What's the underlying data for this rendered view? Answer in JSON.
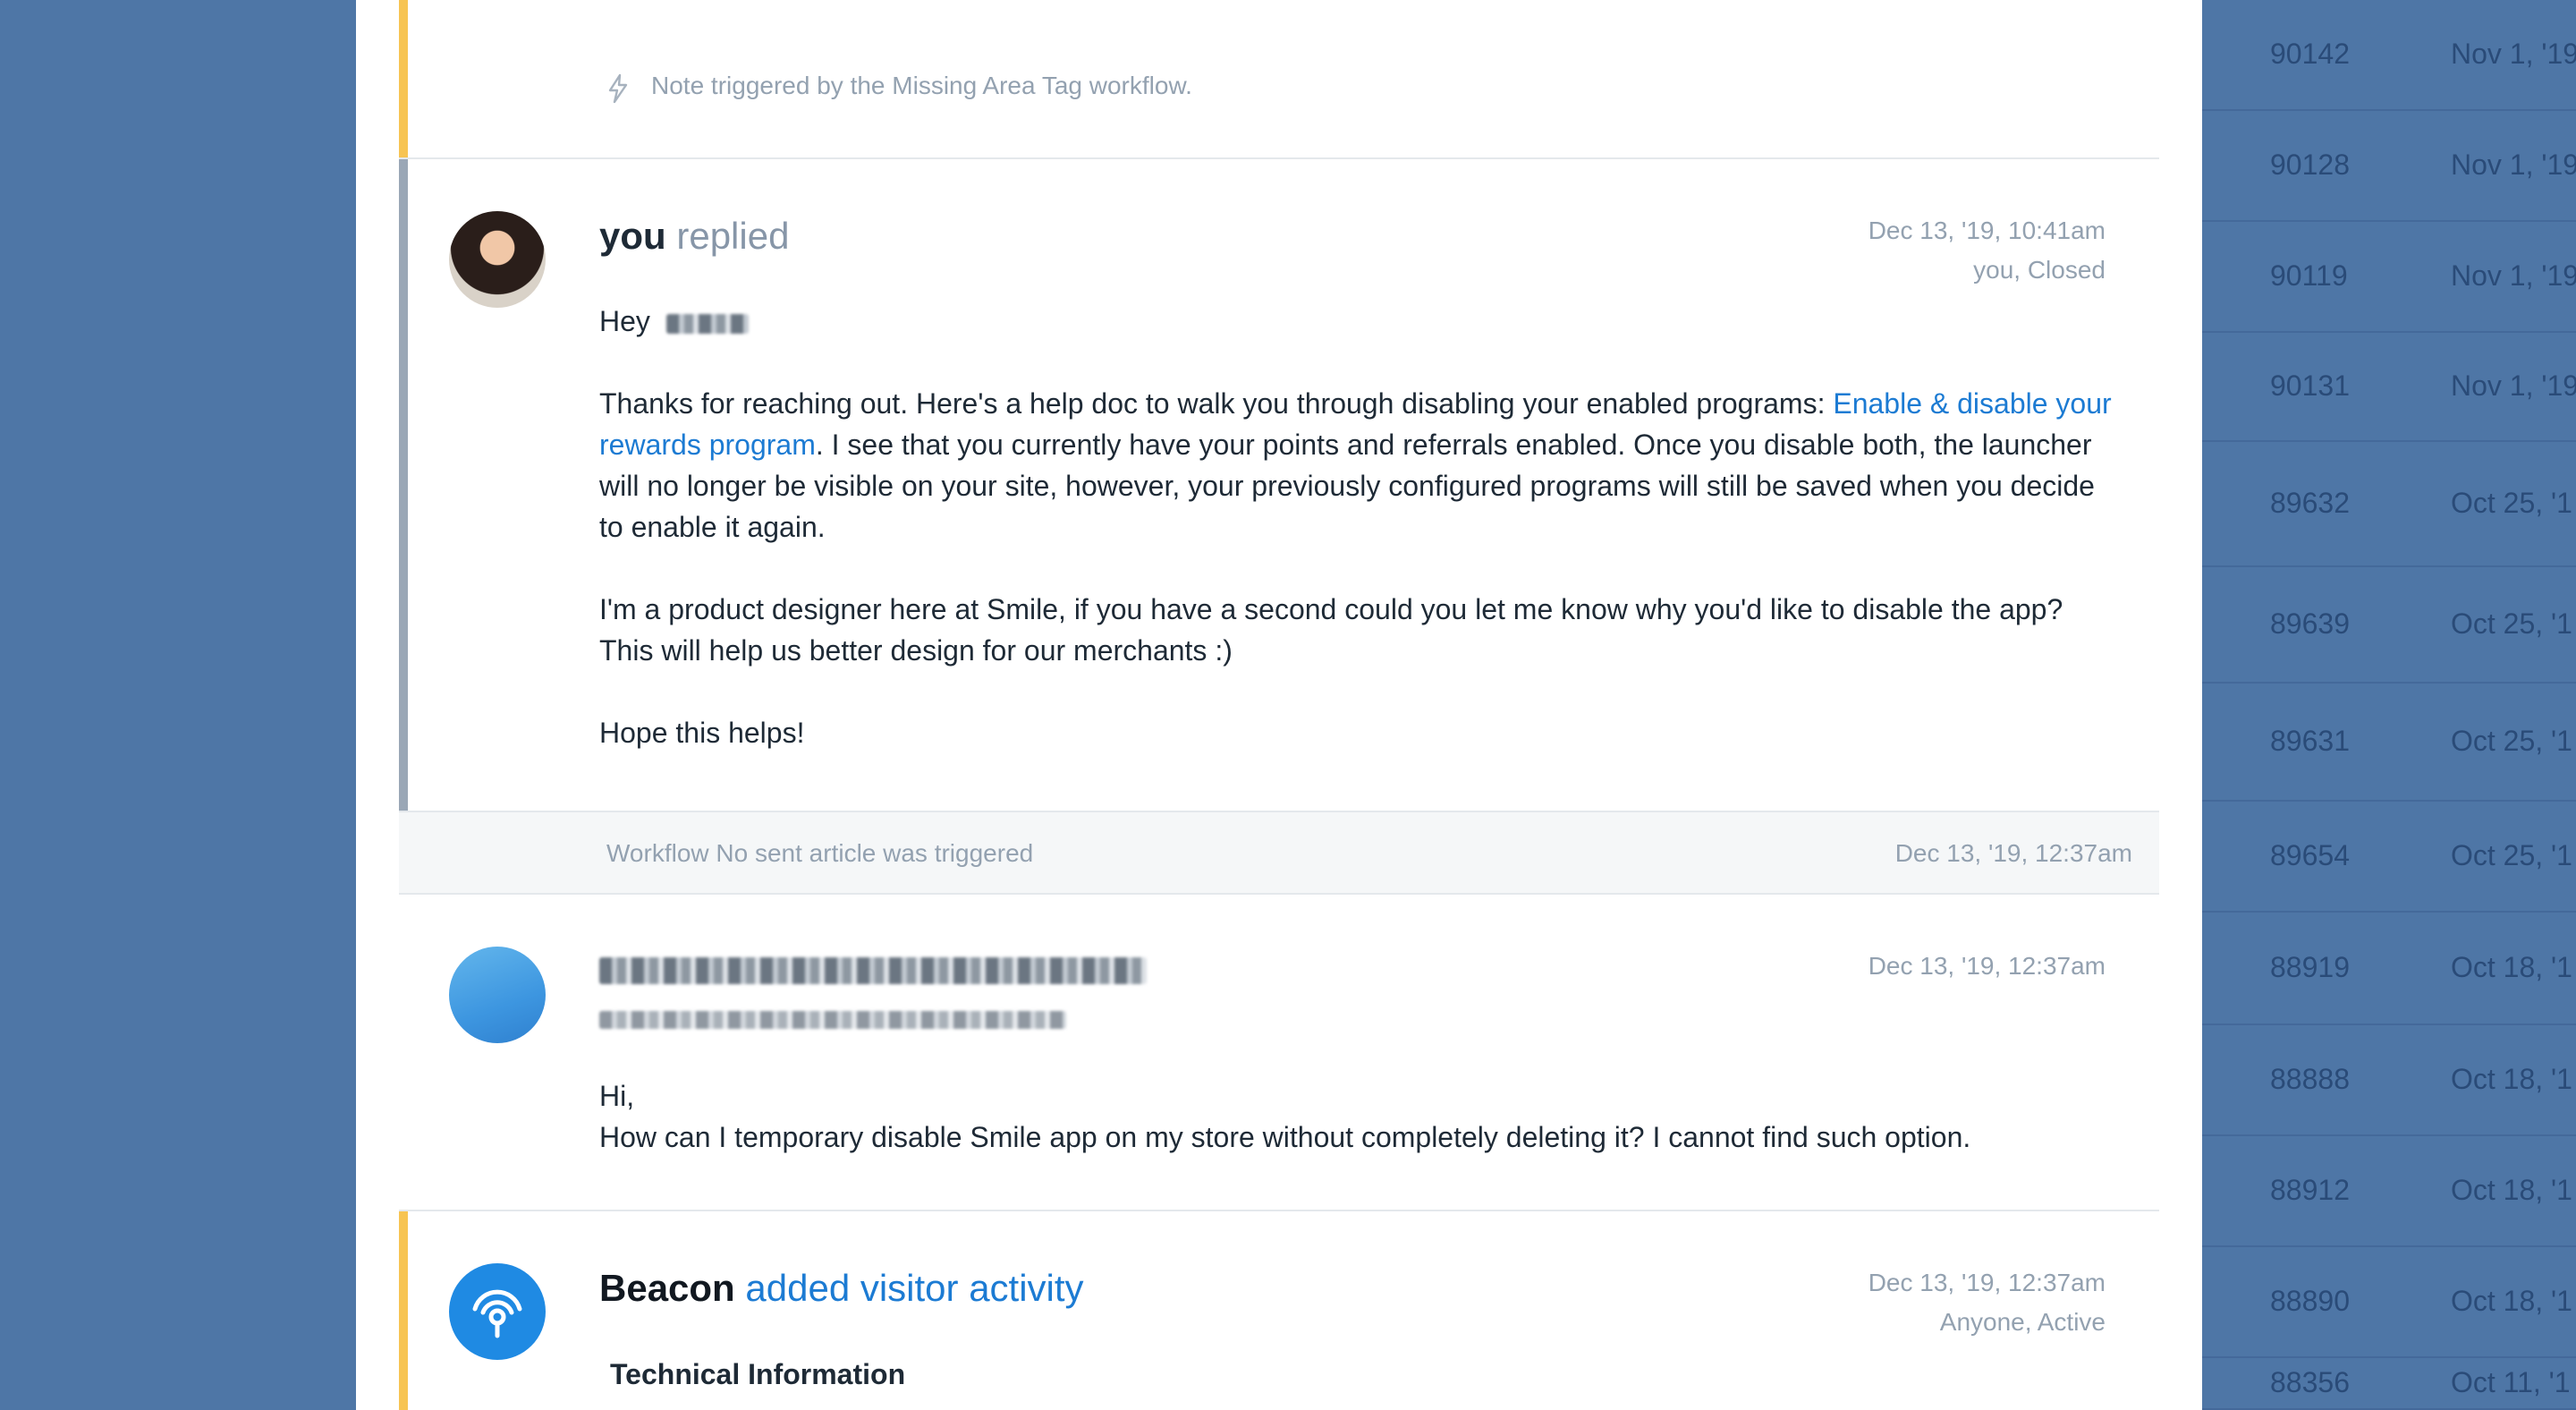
{
  "colors": {
    "background": "#4e76a6",
    "note_bar": "#f7c452",
    "reply_bar": "#9aa7b6",
    "link": "#1c7bd3",
    "text": "#1e2a36",
    "muted": "#93a1b0"
  },
  "ticket_list": [
    {
      "id": "90142",
      "date": "Nov 1, '19"
    },
    {
      "id": "90128",
      "date": "Nov 1, '19"
    },
    {
      "id": "90119",
      "date": "Nov 1, '19"
    },
    {
      "id": "90131",
      "date": "Nov 1, '19"
    },
    {
      "id": "89632",
      "date": "Oct 25, '1"
    },
    {
      "id": "89639",
      "date": "Oct 25, '1"
    },
    {
      "id": "89631",
      "date": "Oct 25, '1"
    },
    {
      "id": "89654",
      "date": "Oct 25, '1"
    },
    {
      "id": "88919",
      "date": "Oct 18, '1"
    },
    {
      "id": "88888",
      "date": "Oct 18, '1"
    },
    {
      "id": "88912",
      "date": "Oct 18, '1"
    },
    {
      "id": "88890",
      "date": "Oct 18, '1"
    },
    {
      "id": "88356",
      "date": "Oct 11, '1"
    }
  ],
  "note": {
    "icon": "lightning-bolt-icon",
    "text": "Note triggered by the Missing Area Tag workflow."
  },
  "reply": {
    "author": "you",
    "action": "replied",
    "timestamp": "Dec 13, '19, 10:41am",
    "status": "you, Closed",
    "greeting": "Hey",
    "para1_before": "Thanks for reaching out. Here's a help doc to walk you through disabling your enabled programs: ",
    "para1_link": "Enable & disable your rewards program",
    "para1_after": ". I see that you currently have your points and referrals enabled. Once you disable both, the launcher will no longer be visible on your site, however, your previously configured programs will still be saved when you decide to enable it again.",
    "para2": "I'm a product designer here at Smile, if you have a second could you let me know why you'd like to disable the app? This will help us better design for our merchants :)",
    "para3": "Hope this helps!"
  },
  "workflow": {
    "text": "Workflow No sent article was triggered",
    "timestamp": "Dec 13, '19, 12:37am"
  },
  "customer_message": {
    "timestamp": "Dec 13, '19, 12:37am",
    "line1": "Hi,",
    "line2": "How can I temporary disable Smile app on my store without completely deleting it? I cannot find such option."
  },
  "beacon": {
    "author": "Beacon",
    "action": "added visitor activity",
    "timestamp": "Dec 13, '19, 12:37am",
    "status": "Anyone, Active",
    "section_title": "Technical Information",
    "icon": "beacon-signal-icon"
  }
}
